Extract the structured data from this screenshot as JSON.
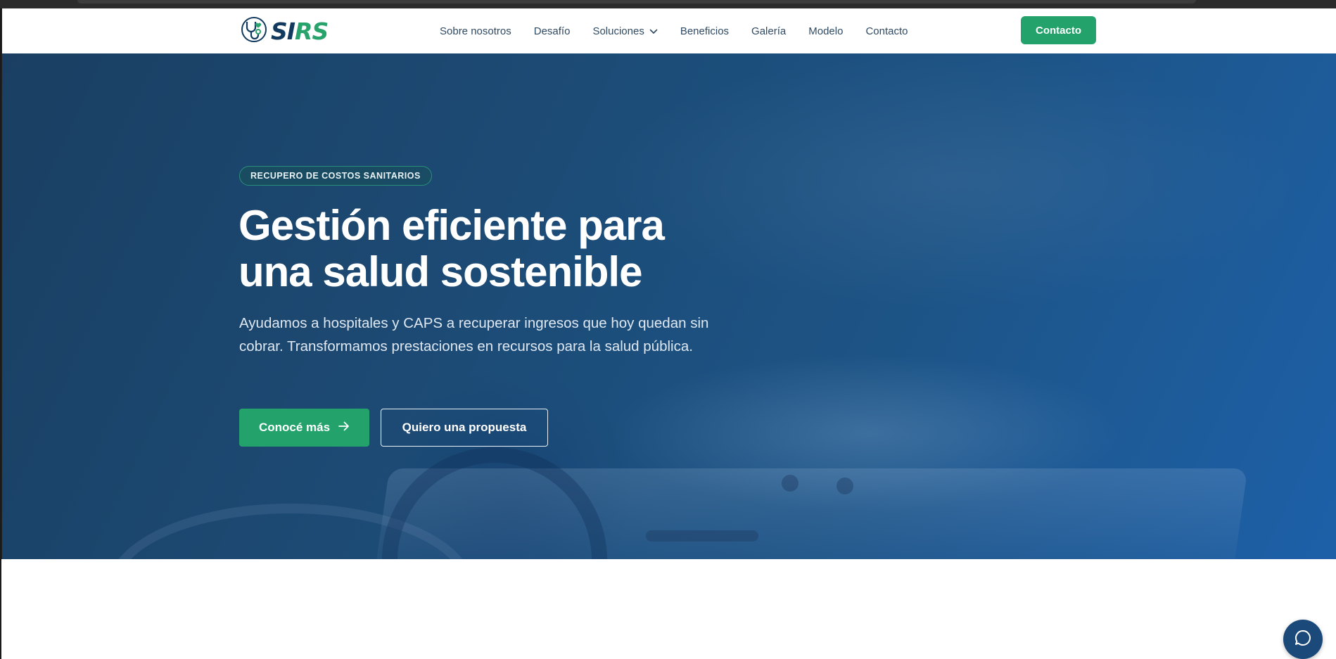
{
  "brand": {
    "logo_text_part1": "SI",
    "logo_text_part2": "RS",
    "colors": {
      "navy": "#123a5e",
      "green": "#23a26b"
    },
    "logo_icon": "stethoscope-heart-icon"
  },
  "nav": {
    "items": [
      {
        "label": "Sobre nosotros"
      },
      {
        "label": "Desafío"
      },
      {
        "label": "Soluciones",
        "has_dropdown": true,
        "icon": "chevron-down-icon"
      },
      {
        "label": "Beneficios"
      },
      {
        "label": "Galería"
      },
      {
        "label": "Modelo"
      },
      {
        "label": "Contacto"
      }
    ],
    "cta_label": "Contacto"
  },
  "hero": {
    "badge": "RECUPERO DE COSTOS SANITARIOS",
    "title_line1": "Gestión eficiente para",
    "title_line2": "una salud sostenible",
    "subtitle": "Ayudamos a hospitales y CAPS a recuperar ingresos que hoy quedan sin cobrar. Transformamos prestaciones en recursos para la salud pública.",
    "primary_button": "Conocé más",
    "primary_button_icon": "arrow-right-icon",
    "secondary_button": "Quiero una propuesta"
  },
  "chat": {
    "icon": "chat-bubble-icon",
    "color": "#1b4a7a"
  }
}
